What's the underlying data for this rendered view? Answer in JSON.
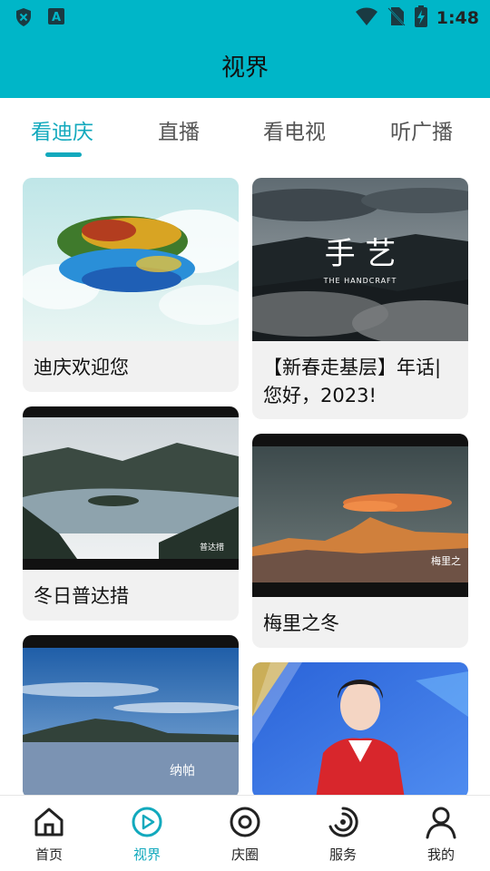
{
  "status_bar": {
    "time": "1:48",
    "left_icons": [
      "shield-icon",
      "a-letter-icon"
    ],
    "right_icons": [
      "wifi-icon",
      "no-sim-icon",
      "battery-charging-icon"
    ]
  },
  "header": {
    "title": "视界"
  },
  "tabs": [
    {
      "label": "看迪庆",
      "active": true
    },
    {
      "label": "直播",
      "active": false
    },
    {
      "label": "看电视",
      "active": false
    },
    {
      "label": "听广播",
      "active": false
    }
  ],
  "colors": {
    "accent": "#12a9bd",
    "header_bg": "#00b6c8",
    "card_bg": "#f1f1f1"
  },
  "cards": [
    {
      "title": "迪庆欢迎您",
      "thumb_text": ""
    },
    {
      "title": "【新春走基层】年话|  您好，2023!",
      "thumb_text": "手 艺",
      "thumb_subtext": "THE HANDCRAFT"
    },
    {
      "title": "冬日普达措",
      "thumb_text": "普达措"
    },
    {
      "title": "梅里之冬",
      "thumb_text": "梅里之"
    },
    {
      "title": "",
      "thumb_text": "纳帕"
    },
    {
      "title": "",
      "thumb_text": ""
    }
  ],
  "bottom_nav": [
    {
      "label": "首页",
      "icon": "home-icon",
      "active": false
    },
    {
      "label": "视界",
      "icon": "play-circle-icon",
      "active": true
    },
    {
      "label": "庆圈",
      "icon": "ring-icon",
      "active": false
    },
    {
      "label": "服务",
      "icon": "swirl-icon",
      "active": false
    },
    {
      "label": "我的",
      "icon": "person-icon",
      "active": false
    }
  ]
}
